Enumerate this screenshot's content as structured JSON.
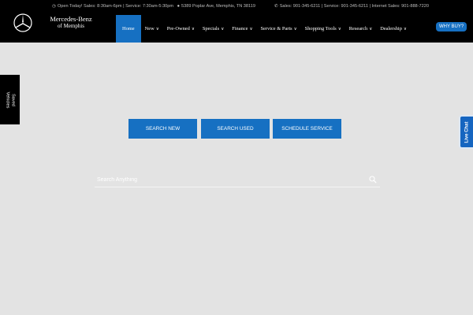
{
  "header": {
    "brand_line1": "Mercedes-Benz",
    "brand_line2": "of Memphis",
    "topbar_left": "Open Today! Sales: 8:30am-6pm | Service: 7:30am-5:30pm",
    "address": "5389 Poplar Ave, Memphis, TN 38119",
    "phones": "Sales: 901-345-6211 | Service: 901-345-6211 | Internet Sales: 901-888-7220",
    "logo_icon": "mercedes-star-logo",
    "accent_color": "#1670c2"
  },
  "nav": {
    "home": "Home",
    "new": "New",
    "pre_owned": "Pre-Owned",
    "specials": "Specials",
    "finance": "Finance",
    "service_parts": "Service & Parts",
    "shopping_tools": "Shopping Tools",
    "research": "Research",
    "dealership": "Dealership",
    "why_buy": "WHY BUY?"
  },
  "saved_vehicles": {
    "line1": "Saved",
    "line2": "Vehicles"
  },
  "live_chat": "Live Chat",
  "cta": {
    "search_new": "SEARCH NEW",
    "search_used": "SEARCH USED",
    "schedule_service": "SCHEDULE SERVICE"
  },
  "search": {
    "placeholder": "Search Anything",
    "icon": "search-icon"
  }
}
